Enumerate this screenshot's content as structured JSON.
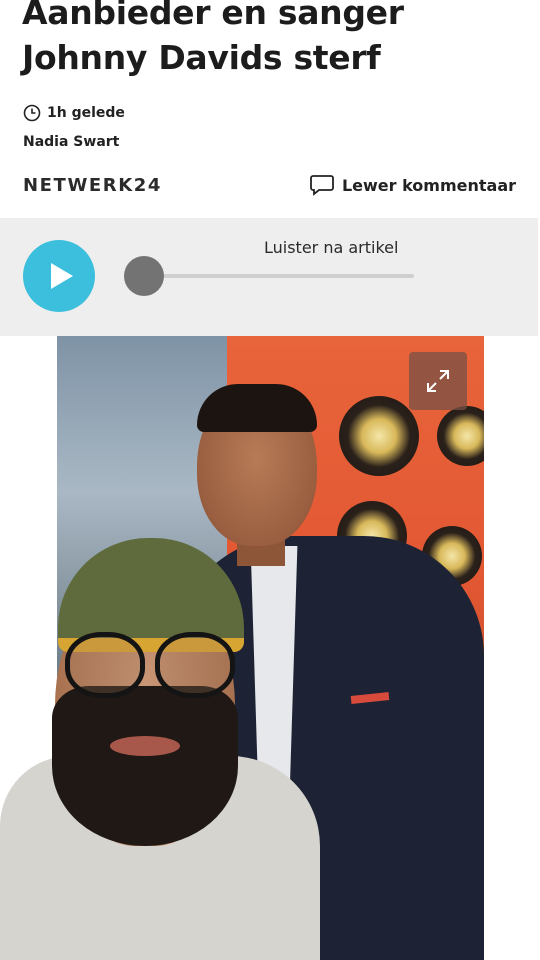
{
  "article": {
    "title": "Aanbieder en sanger Johnny Davids sterf",
    "time": "1h gelede",
    "author": "Nadia Swart"
  },
  "brand": {
    "logo_text": "NETWERK24"
  },
  "comments": {
    "label": "Lewer kommentaar"
  },
  "audio": {
    "label": "Luister na artikel",
    "progress": 0,
    "accent_color": "#3cbfdc"
  },
  "icons": {
    "time": "clock-icon",
    "comment": "speech-bubble-icon",
    "play": "play-icon",
    "expand": "expand-icon"
  }
}
